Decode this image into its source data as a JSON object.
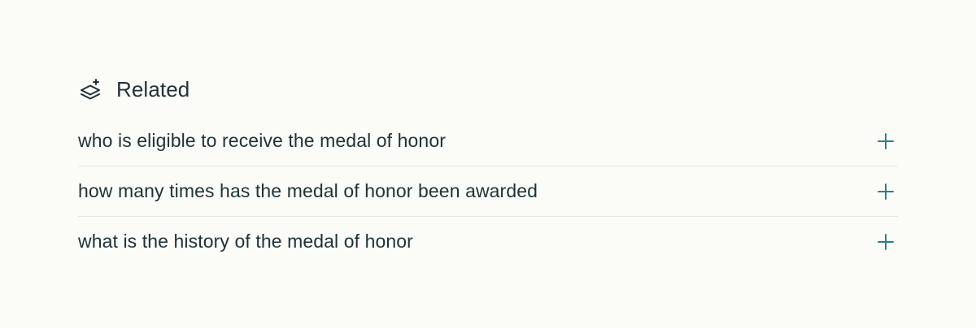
{
  "related": {
    "title": "Related",
    "header_icon": "layers-sparkle-icon",
    "items": [
      {
        "label": "who is eligible to receive the medal of honor",
        "action_icon": "plus-icon"
      },
      {
        "label": "how many times has the medal of honor been awarded",
        "action_icon": "plus-icon"
      },
      {
        "label": "what is the history of the medal of honor",
        "action_icon": "plus-icon"
      }
    ]
  },
  "colors": {
    "background": "#fbfbf8",
    "text": "#1f3237",
    "accent": "#2a7f8a",
    "divider": "#e2e4e1"
  }
}
